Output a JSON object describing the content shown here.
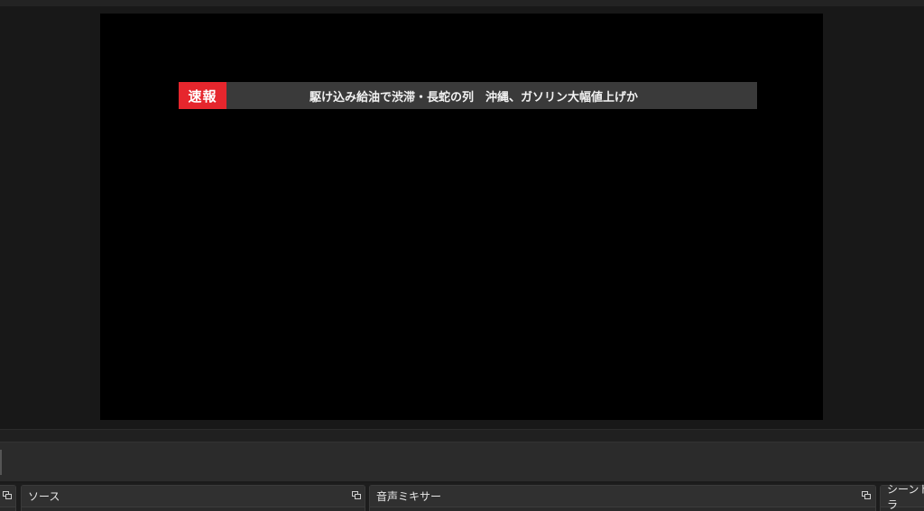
{
  "preview": {
    "ticker": {
      "badge": "速報",
      "headline": "駆け込み給油で渋滞・長蛇の列　沖縄、ガソリン大幅値上げか"
    }
  },
  "docks": {
    "sources": {
      "title": "ソース"
    },
    "mixer": {
      "title": "音声ミキサー"
    },
    "transitions": {
      "title": "シーントラ"
    }
  },
  "colors": {
    "badge": "#e6262d",
    "ticker_bg": "#3a3a3a",
    "canvas": "#000000",
    "app_bg": "#1a1a1a"
  }
}
